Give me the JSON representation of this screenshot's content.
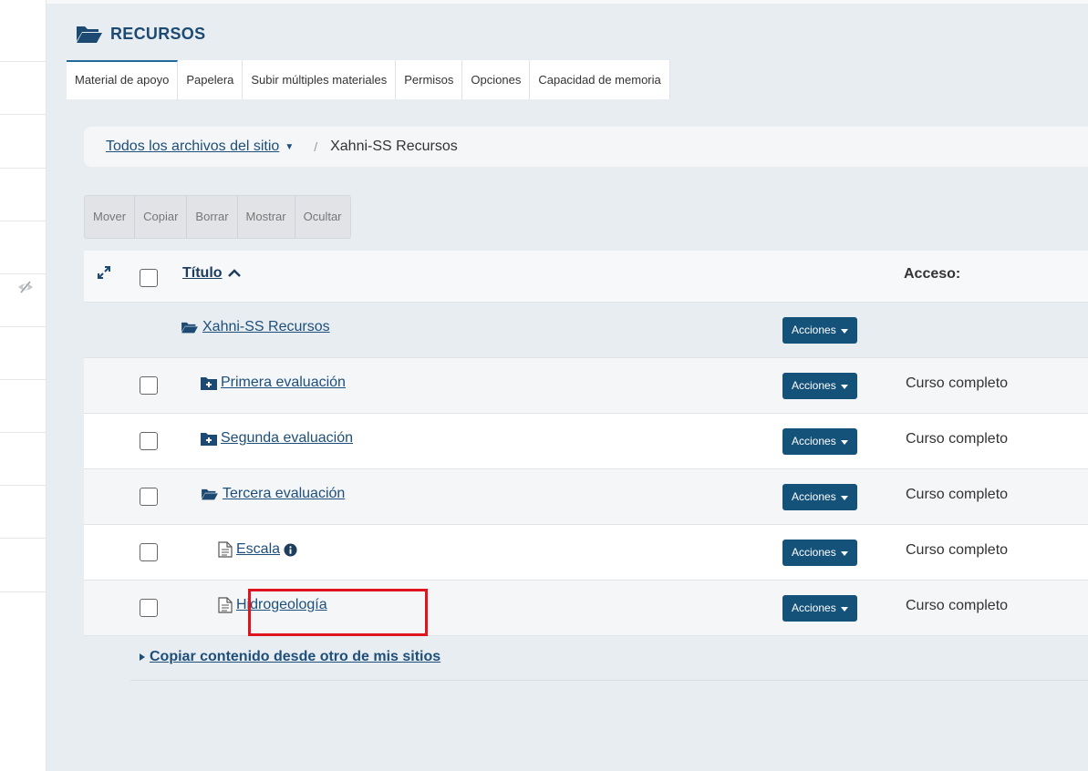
{
  "tool": {
    "title": "RECURSOS",
    "icon": "folder-open-icon"
  },
  "tabs": [
    {
      "label": "Material de apoyo",
      "active": true
    },
    {
      "label": "Papelera"
    },
    {
      "label": "Subir múltiples materiales"
    },
    {
      "label": "Permisos"
    },
    {
      "label": "Opciones"
    },
    {
      "label": "Capacidad de memoria"
    }
  ],
  "breadcrumb": {
    "root": "Todos los archivos del sitio",
    "separator": "/",
    "current": "Xahni-SS Recursos"
  },
  "toolbar": {
    "move": "Mover",
    "copy": "Copiar",
    "delete": "Borrar",
    "show": "Mostrar",
    "hide": "Ocultar"
  },
  "table": {
    "title_header": "Título",
    "access_header": "Acceso:",
    "root_folder": {
      "name": "Xahni-SS Recursos",
      "actions": "Acciones"
    },
    "rows": [
      {
        "name": "Primera evaluación",
        "icon": "folder-plus-icon",
        "actions": "Acciones",
        "access": "Curso completo"
      },
      {
        "name": "Segunda evaluación",
        "icon": "folder-plus-icon",
        "actions": "Acciones",
        "access": "Curso completo"
      },
      {
        "name": "Tercera evaluación",
        "icon": "folder-open-icon",
        "actions": "Acciones",
        "access": "Curso completo"
      },
      {
        "name": "Escala",
        "icon": "file-text-icon",
        "actions": "Acciones",
        "access": "Curso completo",
        "info_icon": "info-circle-icon"
      },
      {
        "name": "Hidrogeología",
        "icon": "file-text-icon",
        "actions": "Acciones",
        "access": "Curso completo",
        "highlighted": true
      }
    ]
  },
  "copy_link": "Copiar contenido desde otro de mis sitios",
  "colors": {
    "accent": "#14527a",
    "title": "#1d4a72",
    "link": "#1d4f7a",
    "highlight": "#e0141e",
    "background": "#e8edf1"
  }
}
